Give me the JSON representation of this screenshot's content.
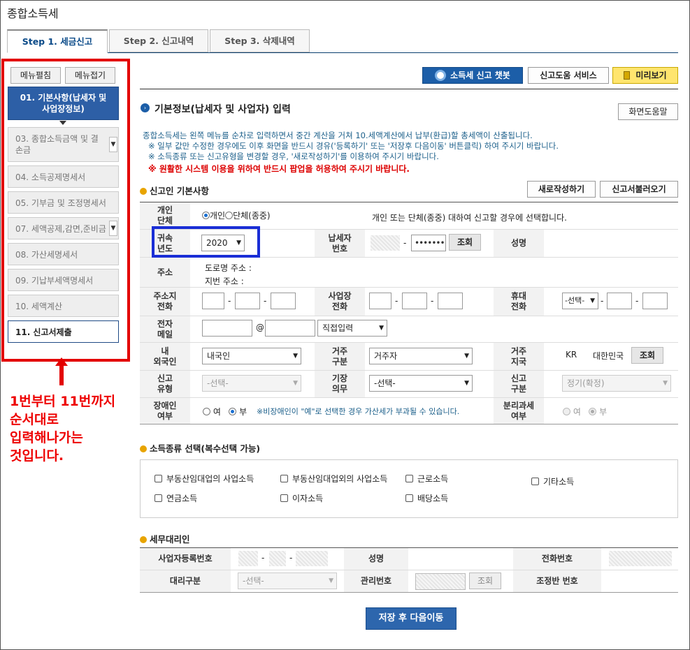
{
  "page_title": "종합소득세",
  "tabs": [
    "Step 1. 세금신고",
    "Step 2. 신고내역",
    "Step 3. 삭제내역"
  ],
  "sidebar": {
    "expand": "메뉴펼침",
    "collapse": "메뉴접기",
    "items": [
      "01. 기본사항(납세자 및 사업장정보)",
      "03. 종합소득금액 및 결손금",
      "04. 소득공제명세서",
      "05. 기부금 및 조정명세서",
      "07. 세액공제,감면,준비금",
      "08. 가산세명세서",
      "09. 기납부세액명세서",
      "10. 세액계산",
      "11. 신고서제출"
    ]
  },
  "annotation": "1번부터 11번까지\n순서대로\n입력해나가는\n것입니다.",
  "top_buttons": {
    "chatbot": "소득세 신고 챗봇",
    "help_service": "신고도움 서비스",
    "preview": "미리보기"
  },
  "section_title": "기본정보(납세자 및 사업자) 입력",
  "screen_help": "화면도움말",
  "notes": [
    "종합소득세는 왼쪽 메뉴를 순차로 입력하면서 중간 계산을 거쳐 10.세액계산에서 납부(환급)할 총세액이 산출됩니다.",
    "※ 일부 값만 수정한 경우에도 이후 화면을 반드시 경유('등록하기' 또는 '저장후 다음이동' 버튼클릭) 하여 주시기 바랍니다.",
    "※ 소득종류 또는 신고유형을 변경할 경우, '새로작성하기'를 이용하여 주시기 바랍니다.",
    "※ 원활한 시스템 이용을 위하여 반드시 팝업을 허용하여 주시기 바랍니다."
  ],
  "basic": {
    "title": "신고인 기본사항",
    "new_btn": "새로작성하기",
    "load_btn": "신고서불러오기",
    "type_label": "개인\n단체",
    "type_opt1": "개인",
    "type_opt2": "단체(종중)",
    "type_desc": "개인 또는 단체(종중) 대하여 신고할 경우에 선택합니다.",
    "year_label": "귀속\n년도",
    "year_value": "2020",
    "taxpayer_label": "납세자\n번호",
    "taxpayer_masked": "•••••••",
    "lookup": "조회",
    "name_label": "성명",
    "address_label": "주소",
    "road_addr": "도로명 주소 :",
    "lot_addr": "지번 주소 :",
    "home_phone_label": "주소지\n전화",
    "biz_phone_label": "사업장\n전화",
    "mobile_label": "휴대\n전화",
    "mobile_select": "-선택-",
    "email_label": "전자\n메일",
    "email_at": "@",
    "email_domain": "직접입력",
    "nationality_label": "내\n외국인",
    "nationality_value": "내국인",
    "residency_label": "거주\n구분",
    "residency_value": "거주자",
    "country_label": "거주\n지국",
    "country_code": "KR",
    "country_name": "대한민국",
    "report_type_label": "신고\n유형",
    "report_type_value": "-선택-",
    "bookkeeping_label": "기장\n의무",
    "bookkeeping_value": "-선택-",
    "report_div_label": "신고\n구분",
    "report_div_value": "정기(확정)",
    "disabled_label": "장애인\n여부",
    "yes": "여",
    "no": "부",
    "disabled_note": "※비장애인이 \"예\"로 선택한 경우 가산세가 부과될 수 있습니다.",
    "sep_tax_label": "분리과세\n여부"
  },
  "income": {
    "title": "소득종류 선택(복수선택 가능)",
    "options": [
      "부동산임대업의 사업소득",
      "부동산임대업외의 사업소득",
      "근로소득",
      "기타소득",
      "연금소득",
      "이자소득",
      "배당소득"
    ]
  },
  "agent": {
    "title": "세무대리인",
    "biz_no_label": "사업자등록번호",
    "name_label": "성명",
    "phone_label": "전화번호",
    "agent_type_label": "대리구분",
    "agent_type_value": "-선택-",
    "mgmt_no_label": "관리번호",
    "lookup": "조회",
    "team_no_label": "조정반 번호"
  },
  "save_next": "저장 후 다음이동"
}
